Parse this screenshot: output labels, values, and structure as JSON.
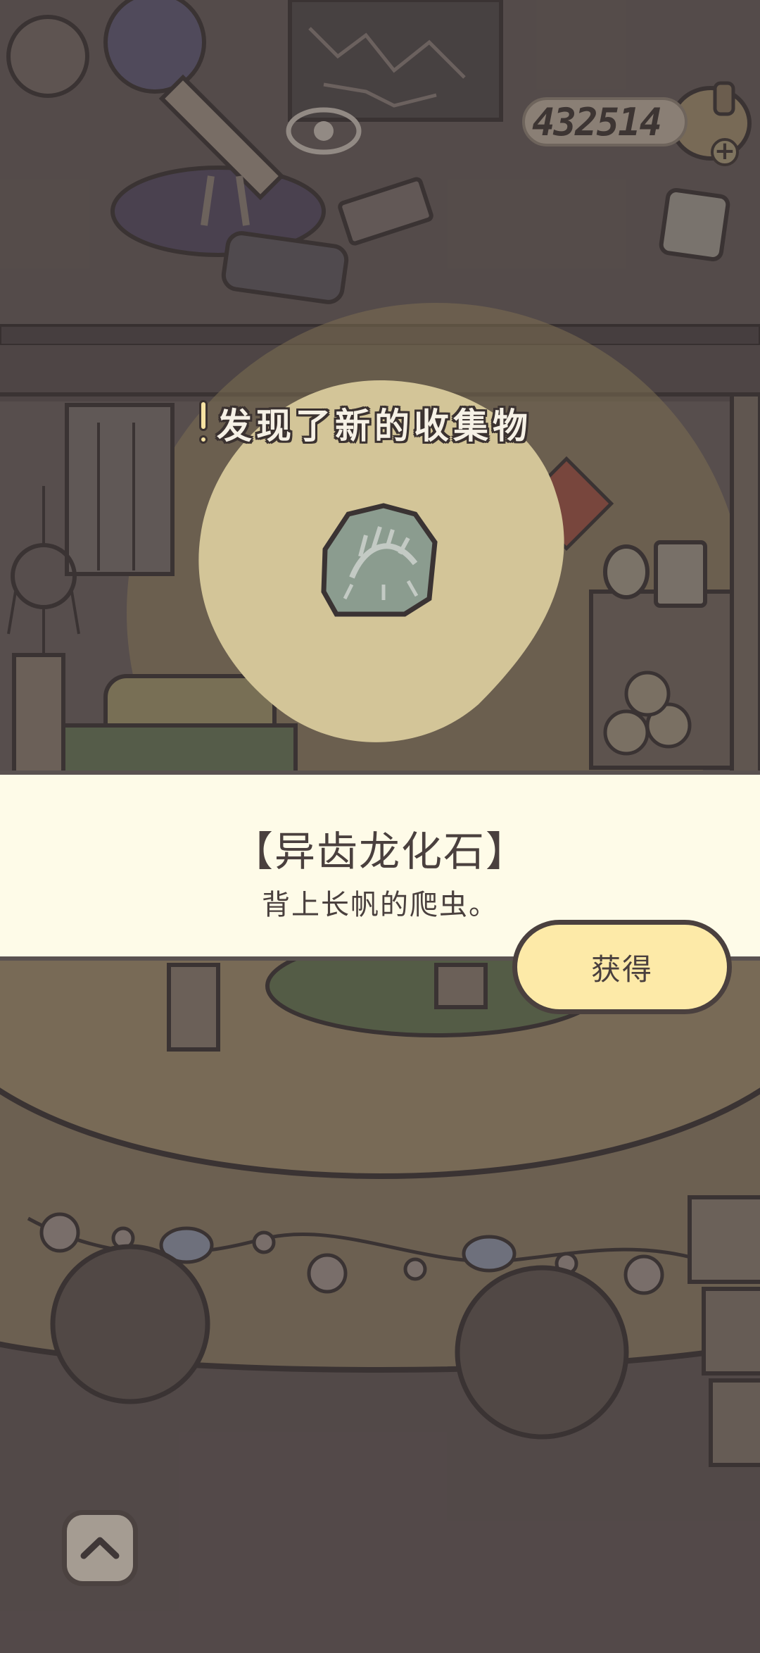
{
  "hud": {
    "coins": "432514",
    "add_coins_icon": "plus-icon"
  },
  "discovery": {
    "banner_text": "发现了新的收集物",
    "icon": "exclamation-icon"
  },
  "item": {
    "name": "【异齿龙化石】",
    "description": "背上长帆的爬虫。",
    "icon": "dimetrodon-fossil-icon"
  },
  "actions": {
    "obtain_label": "获得",
    "scroll_up_icon": "chevron-up-icon"
  },
  "colors": {
    "background": "#5c5251",
    "card": "#fefbe8",
    "button": "#fdeaa8",
    "highlight": "#f9eab2",
    "outline": "#4a403e"
  }
}
